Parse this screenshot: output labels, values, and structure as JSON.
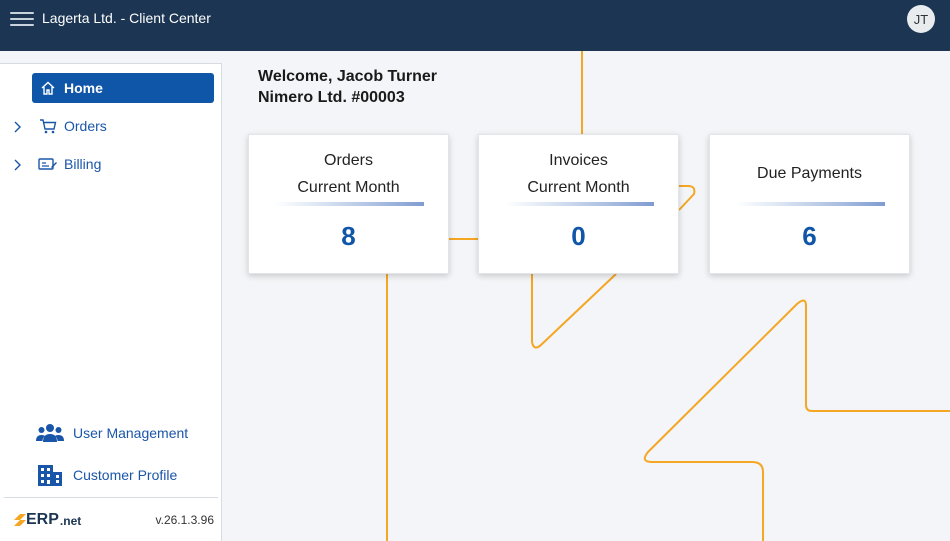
{
  "header": {
    "title": "Lagerta Ltd. - Client Center",
    "avatar_initials": "JT",
    "background": "#1b3553"
  },
  "sidebar": {
    "items": [
      {
        "label": "Home",
        "icon": "home-icon",
        "active": true
      },
      {
        "label": "Orders",
        "icon": "cart-icon",
        "active": false,
        "expandable": true
      },
      {
        "label": "Billing",
        "icon": "billing-icon",
        "active": false,
        "expandable": true
      }
    ],
    "bottom_items": [
      {
        "label": "User Management",
        "icon": "users-icon"
      },
      {
        "label": "Customer Profile",
        "icon": "building-icon"
      }
    ],
    "footer": {
      "logo_text": "ERP",
      "logo_suffix": ".net",
      "version": "v.26.1.3.96"
    }
  },
  "main": {
    "welcome_line1": "Welcome, Jacob Turner",
    "welcome_line2": "Nimero Ltd. #00003",
    "cards": [
      {
        "title1": "Orders",
        "title2": "Current Month",
        "value": "8"
      },
      {
        "title1": "Invoices",
        "title2": "Current Month",
        "value": "0"
      },
      {
        "title1": "Due Payments",
        "title2": "",
        "value": "6"
      }
    ]
  },
  "colors": {
    "accent": "#0f55a8",
    "decor_line": "#f5a623",
    "logo_orange": "#f5a623"
  }
}
